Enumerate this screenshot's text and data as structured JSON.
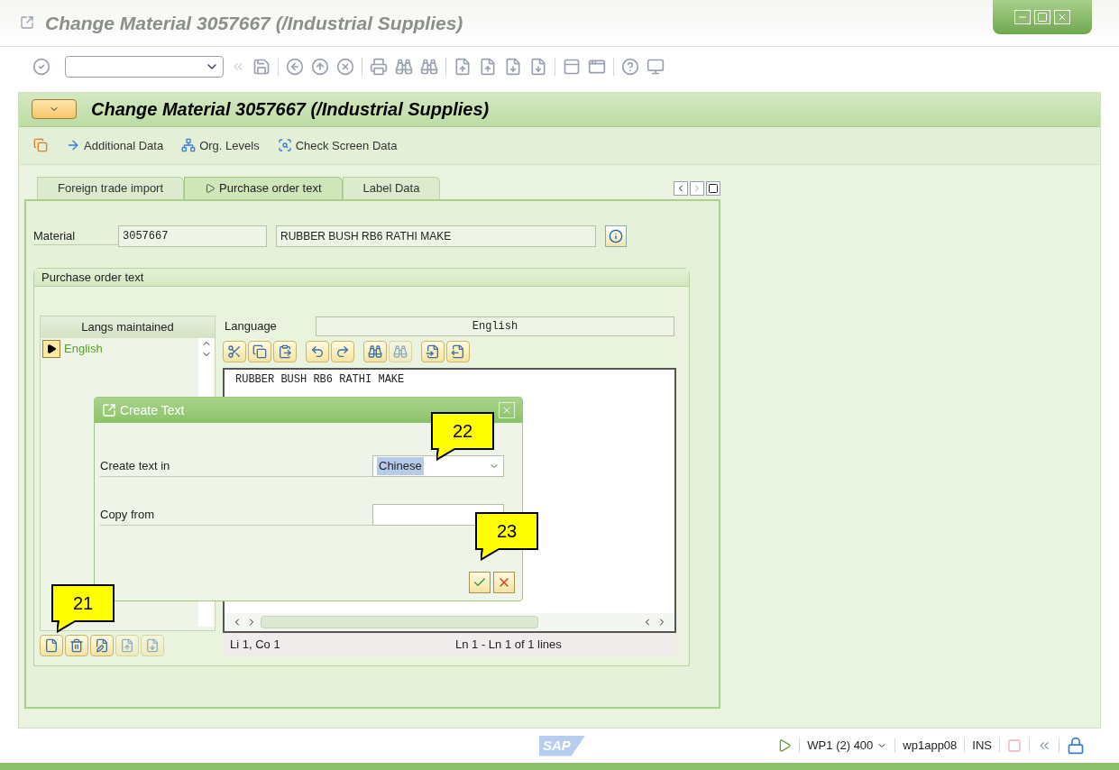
{
  "window": {
    "title": "Change Material 3057667 (/Industrial Supplies)"
  },
  "screen_header": {
    "title": "Change Material 3057667 (/Industrial Supplies)"
  },
  "app_toolbar": [
    {
      "kind": "additional",
      "label": "Additional Data"
    },
    {
      "kind": "org",
      "label": "Org. Levels"
    },
    {
      "kind": "check",
      "label": "Check Screen Data"
    }
  ],
  "tabs": [
    {
      "label": "Foreign trade import",
      "selected": false
    },
    {
      "label": "Purchase order text",
      "selected": true
    },
    {
      "label": "Label Data",
      "selected": false
    }
  ],
  "material": {
    "label": "Material",
    "number": "3057667",
    "description": "RUBBER BUSH RB6 RATHI MAKE"
  },
  "group": {
    "title": "Purchase order text"
  },
  "langs": {
    "header": "Langs maintained",
    "items": [
      {
        "label": "English",
        "selected": true
      }
    ]
  },
  "language": {
    "label": "Language",
    "value": "English"
  },
  "editor": {
    "lines": [
      "RUBBER BUSH RB6 RATHI MAKE"
    ],
    "position": "Li 1, Co 1",
    "range": "Ln 1 - Ln 1 of 1 lines"
  },
  "dialog": {
    "title": "Create Text",
    "fields": [
      {
        "kind": "dropdown",
        "label": "Create text in",
        "value": "Chinese"
      },
      {
        "kind": "search",
        "label": "Copy from"
      }
    ]
  },
  "callouts": [
    {
      "label": "21"
    },
    {
      "label": "22"
    },
    {
      "label": "23"
    }
  ],
  "status_bar": {
    "logo": "SAP",
    "system": "WP1 (2) 400",
    "server": "wp1app08",
    "mode": "INS"
  }
}
